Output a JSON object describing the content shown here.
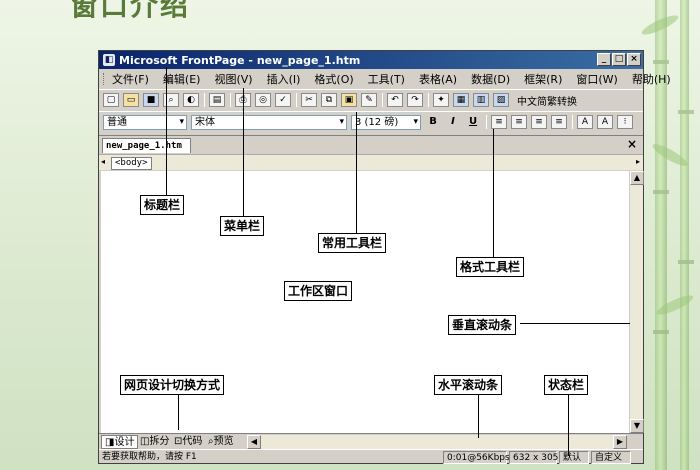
{
  "slide": {
    "title": "窗口介绍"
  },
  "window": {
    "title": "Microsoft FrontPage - new_page_1.htm",
    "controls": [
      "_",
      "□",
      "×"
    ]
  },
  "menu": [
    "文件(F)",
    "编辑(E)",
    "视图(V)",
    "插入(I)",
    "格式(O)",
    "工具(T)",
    "表格(A)",
    "数据(D)",
    "框架(R)",
    "窗口(W)",
    "帮助(H)"
  ],
  "toolbar": {
    "convert_label": "中文简繁转换"
  },
  "format_toolbar": {
    "style": "普通",
    "font": "宋体",
    "size": "3 (12 磅)",
    "bold": "B",
    "italic": "I",
    "underline": "U"
  },
  "tab": {
    "label": "new_page_1.htm",
    "close": "×"
  },
  "tagbar": {
    "tag": "<body>"
  },
  "view_buttons": {
    "design": "设计",
    "split": "拆分",
    "code": "代码",
    "preview": "预览"
  },
  "statusbar": {
    "help": "若要获取帮助，请按 F1",
    "speed": "0:01@56Kbps",
    "size": "632 x 305",
    "mode": "默认",
    "custom": "自定义"
  },
  "callouts": {
    "titlebar": "标题栏",
    "menubar": "菜单栏",
    "standard_toolbar": "常用工具栏",
    "format_toolbar": "格式工具栏",
    "workarea": "工作区窗口",
    "vscroll": "垂直滚动条",
    "view_switch": "网页设计切换方式",
    "hscroll": "水平滚动条",
    "statusbar": "状态栏"
  }
}
